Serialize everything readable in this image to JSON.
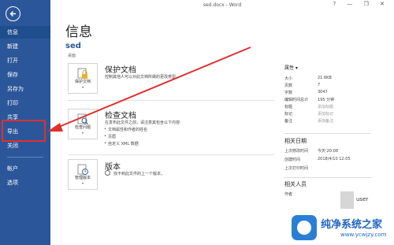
{
  "window": {
    "title": "sed.docx - Word",
    "controls": "? — ❐ ✕"
  },
  "sidebar": {
    "items": [
      {
        "label": "信息"
      },
      {
        "label": "新建"
      },
      {
        "label": "打开"
      },
      {
        "label": "保存"
      },
      {
        "label": "另存为"
      },
      {
        "label": "打印"
      },
      {
        "label": "共享"
      },
      {
        "label": "导出"
      },
      {
        "label": "关闭"
      },
      {
        "label": "帐户"
      },
      {
        "label": "选项"
      }
    ]
  },
  "main": {
    "title": "信息",
    "doc_name": "sed",
    "doc_path": "桌面",
    "protect": {
      "tile_label": "保护文档",
      "title": "保护文档",
      "desc": "控制其他人可以对此文档所做的更改类型。"
    },
    "inspect": {
      "tile_label": "检查问题",
      "title": "检查文档",
      "desc": "在发布此文件之前，请注意其包含以下内容:",
      "bullets": [
        "文档属性和作者的姓名",
        "页眉",
        "自定义 XML 数据"
      ]
    },
    "versions": {
      "tile_label": "管理版本",
      "title": "版本",
      "desc": "找不到此文件的上一个版本。"
    }
  },
  "properties": {
    "title": "属性",
    "rows": [
      {
        "label": "大小",
        "value": "21.6KB",
        "muted": false
      },
      {
        "label": "页数",
        "value": "7",
        "muted": false
      },
      {
        "label": "字数",
        "value": "3047",
        "muted": false
      },
      {
        "label": "编辑时间总计",
        "value": "195 分钟",
        "muted": false
      },
      {
        "label": "标题",
        "value": "添加标题",
        "muted": true
      },
      {
        "label": "标记",
        "value": "添加标记",
        "muted": true
      },
      {
        "label": "备注",
        "value": "添加备注",
        "muted": true
      }
    ]
  },
  "dates": {
    "title": "相关日期",
    "rows": [
      {
        "label": "上次修改时间",
        "value": "今天 20:08"
      },
      {
        "label": "创建时间",
        "value": "2018/4/10 12:05"
      },
      {
        "label": "上次打印时间",
        "value": ""
      }
    ]
  },
  "people": {
    "title": "相关人员",
    "author_label": "作者",
    "author": "user"
  },
  "watermark": {
    "title": "纯净系统之家",
    "url": "www.ycwjzy.com"
  },
  "colors": {
    "sidebar": "#2b579a",
    "highlight": "#e02f2f",
    "accent": "#2b579a"
  }
}
